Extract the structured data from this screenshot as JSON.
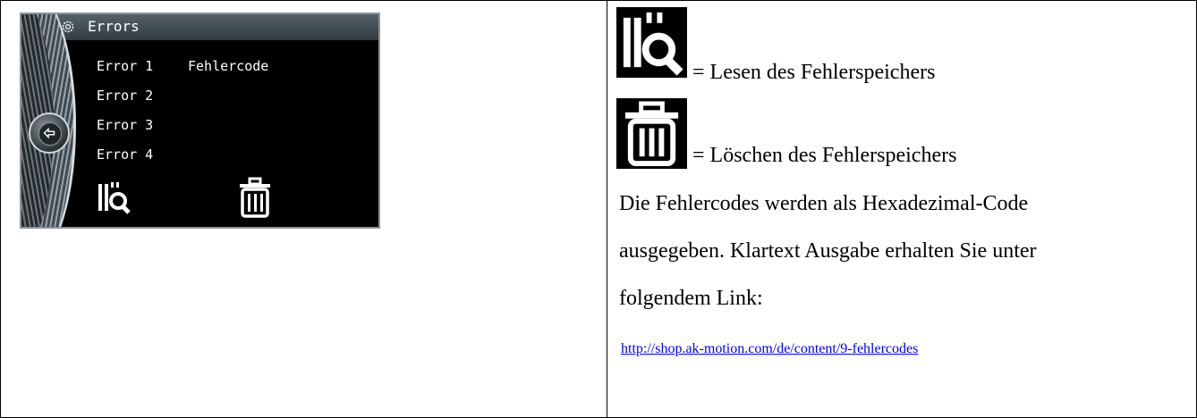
{
  "device": {
    "title": "Errors",
    "errors": [
      "Error 1",
      "Error 2",
      "Error 3",
      "Error 4"
    ],
    "error_code_label": "Fehlercode",
    "icons": [
      "gear-icon",
      "back-icon",
      "read-error-memory-icon",
      "trash-icon"
    ]
  },
  "legend": {
    "read_text": "= Lesen des Fehlerspeichers",
    "delete_text": "= Löschen des Fehlerspeichers"
  },
  "description": {
    "line1": "Die Fehlercodes werden als Hexadezimal-Code",
    "line2": "ausgegeben. Klartext Ausgabe erhalten Sie unter",
    "line3": "folgendem Link:"
  },
  "link": {
    "text": "http://shop.ak-motion.com/de/content/9-fehlercodes",
    "color": "#0000ee"
  }
}
